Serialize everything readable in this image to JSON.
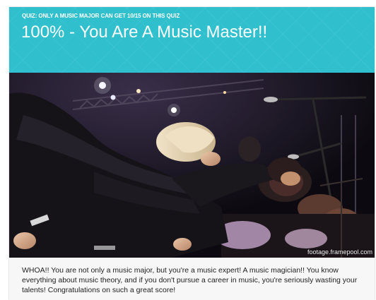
{
  "quiz": {
    "kicker": "QUIZ: ONLY A MUSIC MAJOR CAN GET 10/15 ON THIS QUIZ",
    "result_title": "100% - You Are A Music Master!!"
  },
  "image": {
    "subject": "orchestra-bowing-on-stage",
    "credit": "footage.framepool.com"
  },
  "result": {
    "description": "WHOA!! You are not only a music major, but you're a music expert! A music magician!! You know everything about music theory, and if you don't pursue a career in music, you're seriously wasting your talents! Congratulations on such a great score!"
  },
  "colors": {
    "header_bg": "#2fbfcd",
    "header_text": "#ffffff",
    "body_text": "#222222",
    "card_bg": "#f7f7f7"
  }
}
